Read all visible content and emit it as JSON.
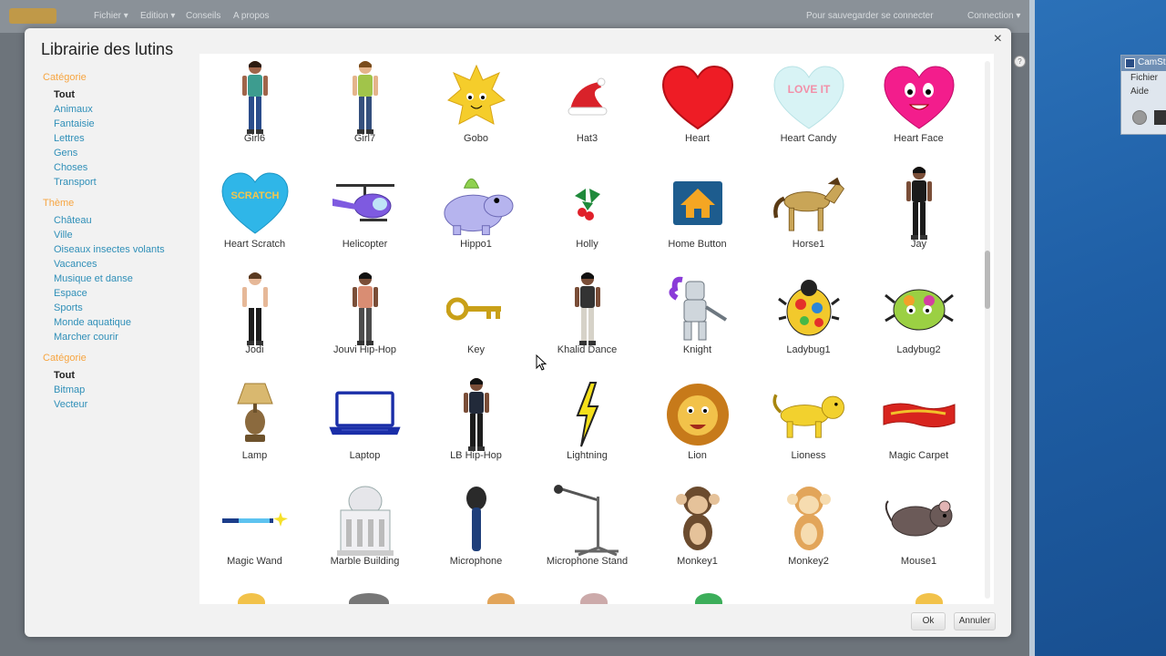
{
  "editor": {
    "menu": [
      "Fichier ▾",
      "Edition ▾",
      "Conseils",
      "A propos"
    ],
    "signin": "Pour sauvegarder se connecter",
    "connect": "Connection ▾"
  },
  "camstudio": {
    "title": "CamSt",
    "menu": [
      "Fichier",
      "Aide"
    ]
  },
  "dialog": {
    "title": "Librairie des lutins",
    "close": "×",
    "ok": "Ok",
    "cancel": "Annuler"
  },
  "sidebar": {
    "category_head": "Catégorie",
    "categories": [
      "Tout",
      "Animaux",
      "Fantaisie",
      "Lettres",
      "Gens",
      "Choses",
      "Transport"
    ],
    "theme_head": "Thème",
    "themes": [
      "Château",
      "Ville",
      "Oiseaux insectes volants",
      "Vacances",
      "Musique et danse",
      "Espace",
      "Sports",
      "Monde aquatique",
      "Marcher courir"
    ],
    "type_head": "Catégorie",
    "types": [
      "Tout",
      "Bitmap",
      "Vecteur"
    ]
  },
  "sprites": [
    {
      "name": "Girl6",
      "icon": "girl-figure-icon"
    },
    {
      "name": "Girl7",
      "icon": "girl-sitting-icon"
    },
    {
      "name": "Gobo",
      "icon": "yellow-creature-icon"
    },
    {
      "name": "Hat3",
      "icon": "santa-hat-icon"
    },
    {
      "name": "Heart",
      "icon": "red-heart-icon"
    },
    {
      "name": "Heart Candy",
      "icon": "candy-heart-icon",
      "text": "LOVE IT"
    },
    {
      "name": "Heart Face",
      "icon": "pink-heart-face-icon"
    },
    {
      "name": "Heart Scratch",
      "icon": "blue-heart-icon",
      "text": "SCRATCH"
    },
    {
      "name": "Helicopter",
      "icon": "helicopter-icon"
    },
    {
      "name": "Hippo1",
      "icon": "hippo-icon"
    },
    {
      "name": "Holly",
      "icon": "holly-icon"
    },
    {
      "name": "Home Button",
      "icon": "home-button-icon"
    },
    {
      "name": "Horse1",
      "icon": "horse-icon"
    },
    {
      "name": "Jay",
      "icon": "dancer-icon"
    },
    {
      "name": "Jodi",
      "icon": "dancer-girl-icon"
    },
    {
      "name": "Jouvi Hip-Hop",
      "icon": "hiphop-dancer-icon"
    },
    {
      "name": "Key",
      "icon": "key-icon"
    },
    {
      "name": "Khalid Dance",
      "icon": "standing-man-icon"
    },
    {
      "name": "Knight",
      "icon": "knight-icon"
    },
    {
      "name": "Ladybug1",
      "icon": "ladybug-icon"
    },
    {
      "name": "Ladybug2",
      "icon": "ladybug-green-icon"
    },
    {
      "name": "Lamp",
      "icon": "lamp-icon"
    },
    {
      "name": "Laptop",
      "icon": "laptop-icon"
    },
    {
      "name": "LB Hip-Hop",
      "icon": "hiphop-woman-icon"
    },
    {
      "name": "Lightning",
      "icon": "lightning-icon"
    },
    {
      "name": "Lion",
      "icon": "lion-icon"
    },
    {
      "name": "Lioness",
      "icon": "lioness-icon"
    },
    {
      "name": "Magic Carpet",
      "icon": "carpet-icon"
    },
    {
      "name": "Magic Wand",
      "icon": "wand-icon"
    },
    {
      "name": "Marble Building",
      "icon": "building-icon"
    },
    {
      "name": "Microphone",
      "icon": "microphone-icon"
    },
    {
      "name": "Microphone Stand",
      "icon": "mic-stand-icon"
    },
    {
      "name": "Monkey1",
      "icon": "monkey-icon"
    },
    {
      "name": "Monkey2",
      "icon": "monkey-light-icon"
    },
    {
      "name": "Mouse1",
      "icon": "mouse-icon"
    }
  ],
  "colors": {
    "category_head": "#f7a541",
    "link": "#2f8fb8",
    "dialog_bg": "#f2f2f2"
  }
}
